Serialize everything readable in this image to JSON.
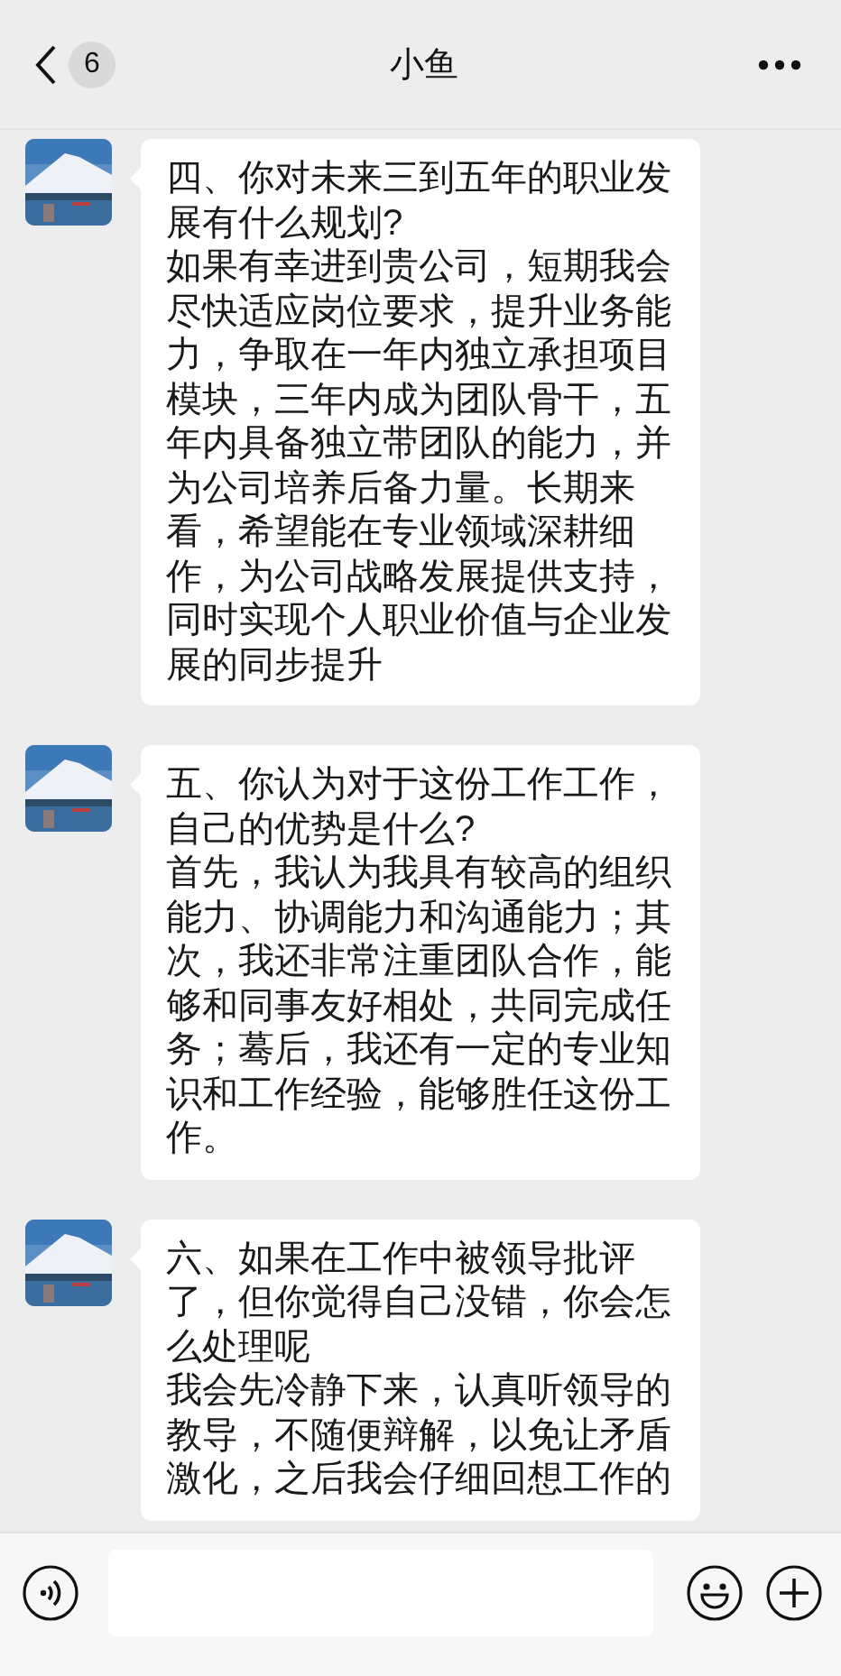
{
  "header": {
    "back_badge": "6",
    "title": "小鱼"
  },
  "messages": [
    {
      "question": "四、你对未来三到五年的职业发展有什么规划?",
      "answer": "如果有幸进到贵公司，短期我会尽快适应岗位要求，提升业务能力，争取在一年内独立承担项目模块，三年内成为团队骨干，五年内具备独立带团队的能力，并为公司培养后备力量。长期来看，希望能在专业领域深耕细作，为公司战略发展提供支持，同时实现个人职业价值与企业发展的同步提升"
    },
    {
      "question": "五、你认为对于这份工作工作，自己的优势是什么?",
      "answer": "首先，我认为我具有较高的组织能力、协调能力和沟通能力；其次，我还非常注重团队合作，能够和同事友好相处，共同完成任务；蓦后，我还有一定的专业知识和工作经验，能够胜任这份工作。"
    },
    {
      "question": "六、如果在工作中被领导批评了，但你觉得自己没错，你会怎么处理呢",
      "answer": "我会先冷静下来，认真听领导的教导，不随便辩解，以免让矛盾激化，之后我会仔细回想工作的"
    }
  ]
}
